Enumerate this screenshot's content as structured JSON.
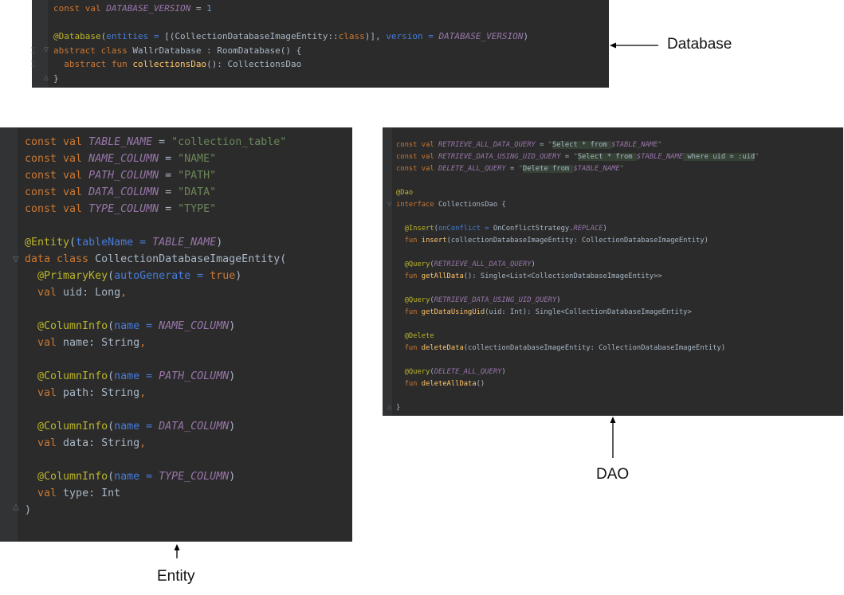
{
  "labels": {
    "database": "Database",
    "entity": "Entity",
    "dao": "DAO"
  },
  "colors": {
    "editor_bg": "#2b2b2b",
    "keyword": "#cc7832",
    "constant": "#9876aa",
    "string": "#6a8759",
    "annotation": "#bbb529",
    "plain": "#a9b7c6",
    "function": "#ffc66d",
    "number": "#6897bb",
    "named_param": "#467cda"
  },
  "database_code": [
    {
      "t": "kw",
      "v": "const val "
    },
    {
      "t": "cst",
      "v": "DATABASE_VERSION"
    },
    {
      "t": "txt",
      "v": " = "
    },
    {
      "t": "num",
      "v": "1"
    },
    {
      "t": "br"
    },
    {
      "t": "br"
    },
    {
      "t": "ann",
      "v": "@Database"
    },
    {
      "t": "txt",
      "v": "("
    },
    {
      "t": "param",
      "v": "entities = "
    },
    {
      "t": "txt",
      "v": "[(CollectionDatabaseImageEntity::"
    },
    {
      "t": "kw",
      "v": "class"
    },
    {
      "t": "txt",
      "v": ")], "
    },
    {
      "t": "param",
      "v": "version = "
    },
    {
      "t": "cst",
      "v": "DATABASE_VERSION"
    },
    {
      "t": "txt",
      "v": ")"
    },
    {
      "t": "br"
    },
    {
      "t": "kw",
      "v": "abstract class "
    },
    {
      "t": "txt",
      "v": "WallrDatabase : RoomDatabase() {"
    },
    {
      "t": "br"
    },
    {
      "t": "txt",
      "v": "  "
    },
    {
      "t": "kw",
      "v": "abstract fun "
    },
    {
      "t": "fn",
      "v": "collectionsDao"
    },
    {
      "t": "txt",
      "v": "(): CollectionsDao"
    },
    {
      "t": "br"
    },
    {
      "t": "txt",
      "v": "}"
    }
  ],
  "entity_code": [
    {
      "t": "kw",
      "v": "const val "
    },
    {
      "t": "cst",
      "v": "TABLE_NAME"
    },
    {
      "t": "txt",
      "v": " = "
    },
    {
      "t": "str",
      "v": "\"collection_table\""
    },
    {
      "t": "br"
    },
    {
      "t": "kw",
      "v": "const val "
    },
    {
      "t": "cst",
      "v": "NAME_COLUMN"
    },
    {
      "t": "txt",
      "v": " = "
    },
    {
      "t": "str",
      "v": "\"NAME\""
    },
    {
      "t": "br"
    },
    {
      "t": "kw",
      "v": "const val "
    },
    {
      "t": "cst",
      "v": "PATH_COLUMN"
    },
    {
      "t": "txt",
      "v": " = "
    },
    {
      "t": "str",
      "v": "\"PATH\""
    },
    {
      "t": "br"
    },
    {
      "t": "kw",
      "v": "const val "
    },
    {
      "t": "cst",
      "v": "DATA_COLUMN"
    },
    {
      "t": "txt",
      "v": " = "
    },
    {
      "t": "str",
      "v": "\"DATA\""
    },
    {
      "t": "br"
    },
    {
      "t": "kw",
      "v": "const val "
    },
    {
      "t": "cst",
      "v": "TYPE_COLUMN"
    },
    {
      "t": "txt",
      "v": " = "
    },
    {
      "t": "str",
      "v": "\"TYPE\""
    },
    {
      "t": "br"
    },
    {
      "t": "br"
    },
    {
      "t": "ann",
      "v": "@Entity"
    },
    {
      "t": "txt",
      "v": "("
    },
    {
      "t": "param",
      "v": "tableName = "
    },
    {
      "t": "cst",
      "v": "TABLE_NAME"
    },
    {
      "t": "txt",
      "v": ")"
    },
    {
      "t": "br"
    },
    {
      "t": "kw",
      "v": "data class "
    },
    {
      "t": "txt",
      "v": "CollectionDatabaseImageEntity("
    },
    {
      "t": "br"
    },
    {
      "t": "txt",
      "v": "  "
    },
    {
      "t": "ann",
      "v": "@PrimaryKey"
    },
    {
      "t": "txt",
      "v": "("
    },
    {
      "t": "param",
      "v": "autoGenerate = "
    },
    {
      "t": "kw",
      "v": "true"
    },
    {
      "t": "txt",
      "v": ")"
    },
    {
      "t": "br"
    },
    {
      "t": "txt",
      "v": "  "
    },
    {
      "t": "kw",
      "v": "val "
    },
    {
      "t": "txt",
      "v": "uid: Long"
    },
    {
      "t": "kw",
      "v": ","
    },
    {
      "t": "br"
    },
    {
      "t": "br"
    },
    {
      "t": "txt",
      "v": "  "
    },
    {
      "t": "ann",
      "v": "@ColumnInfo"
    },
    {
      "t": "txt",
      "v": "("
    },
    {
      "t": "param",
      "v": "name = "
    },
    {
      "t": "cst",
      "v": "NAME_COLUMN"
    },
    {
      "t": "txt",
      "v": ")"
    },
    {
      "t": "br"
    },
    {
      "t": "txt",
      "v": "  "
    },
    {
      "t": "kw",
      "v": "val "
    },
    {
      "t": "txt",
      "v": "name: String"
    },
    {
      "t": "kw",
      "v": ","
    },
    {
      "t": "br"
    },
    {
      "t": "br"
    },
    {
      "t": "txt",
      "v": "  "
    },
    {
      "t": "ann",
      "v": "@ColumnInfo"
    },
    {
      "t": "txt",
      "v": "("
    },
    {
      "t": "param",
      "v": "name = "
    },
    {
      "t": "cst",
      "v": "PATH_COLUMN"
    },
    {
      "t": "txt",
      "v": ")"
    },
    {
      "t": "br"
    },
    {
      "t": "txt",
      "v": "  "
    },
    {
      "t": "kw",
      "v": "val "
    },
    {
      "t": "txt",
      "v": "path: String"
    },
    {
      "t": "kw",
      "v": ","
    },
    {
      "t": "br"
    },
    {
      "t": "br"
    },
    {
      "t": "txt",
      "v": "  "
    },
    {
      "t": "ann",
      "v": "@ColumnInfo"
    },
    {
      "t": "txt",
      "v": "("
    },
    {
      "t": "param",
      "v": "name = "
    },
    {
      "t": "cst",
      "v": "DATA_COLUMN"
    },
    {
      "t": "txt",
      "v": ")"
    },
    {
      "t": "br"
    },
    {
      "t": "txt",
      "v": "  "
    },
    {
      "t": "kw",
      "v": "val "
    },
    {
      "t": "txt",
      "v": "data: String"
    },
    {
      "t": "kw",
      "v": ","
    },
    {
      "t": "br"
    },
    {
      "t": "br"
    },
    {
      "t": "txt",
      "v": "  "
    },
    {
      "t": "ann",
      "v": "@ColumnInfo"
    },
    {
      "t": "txt",
      "v": "("
    },
    {
      "t": "param",
      "v": "name = "
    },
    {
      "t": "cst",
      "v": "TYPE_COLUMN"
    },
    {
      "t": "txt",
      "v": ")"
    },
    {
      "t": "br"
    },
    {
      "t": "txt",
      "v": "  "
    },
    {
      "t": "kw",
      "v": "val "
    },
    {
      "t": "txt",
      "v": "type: Int"
    },
    {
      "t": "br"
    },
    {
      "t": "txt",
      "v": ")"
    }
  ],
  "dao_code": [
    {
      "t": "kw",
      "v": "const val "
    },
    {
      "t": "cst",
      "v": "RETRIEVE_ALL_DATA_QUERY"
    },
    {
      "t": "txt",
      "v": " = "
    },
    {
      "t": "str",
      "v": "\""
    },
    {
      "t": "hl",
      "v": "Select * from "
    },
    {
      "t": "cst",
      "v": "$TABLE_NAME"
    },
    {
      "t": "str",
      "v": "\""
    },
    {
      "t": "br"
    },
    {
      "t": "kw",
      "v": "const val "
    },
    {
      "t": "cst",
      "v": "RETRIEVE_DATA_USING_UID_QUERY"
    },
    {
      "t": "txt",
      "v": " = "
    },
    {
      "t": "str",
      "v": "\""
    },
    {
      "t": "hl",
      "v": "Select * from "
    },
    {
      "t": "cst",
      "v": "$TABLE_NAME"
    },
    {
      "t": "hl",
      "v": " where uid = :uid"
    },
    {
      "t": "str",
      "v": "\""
    },
    {
      "t": "br"
    },
    {
      "t": "kw",
      "v": "const val "
    },
    {
      "t": "cst",
      "v": "DELETE_ALL_QUERY"
    },
    {
      "t": "txt",
      "v": " = "
    },
    {
      "t": "str",
      "v": "\""
    },
    {
      "t": "hl",
      "v": "Delete from "
    },
    {
      "t": "cst",
      "v": "$TABLE_NAME"
    },
    {
      "t": "str",
      "v": "\""
    },
    {
      "t": "br"
    },
    {
      "t": "br"
    },
    {
      "t": "ann",
      "v": "@Dao"
    },
    {
      "t": "br"
    },
    {
      "t": "kw",
      "v": "interface "
    },
    {
      "t": "txt",
      "v": "CollectionsDao {"
    },
    {
      "t": "br"
    },
    {
      "t": "br"
    },
    {
      "t": "txt",
      "v": "  "
    },
    {
      "t": "ann",
      "v": "@Insert"
    },
    {
      "t": "txt",
      "v": "("
    },
    {
      "t": "param",
      "v": "onConflict = "
    },
    {
      "t": "txt",
      "v": "OnConflictStrategy."
    },
    {
      "t": "cst",
      "v": "REPLACE"
    },
    {
      "t": "txt",
      "v": ")"
    },
    {
      "t": "br"
    },
    {
      "t": "txt",
      "v": "  "
    },
    {
      "t": "kw",
      "v": "fun "
    },
    {
      "t": "fn",
      "v": "insert"
    },
    {
      "t": "txt",
      "v": "(collectionDatabaseImageEntity: CollectionDatabaseImageEntity)"
    },
    {
      "t": "br"
    },
    {
      "t": "br"
    },
    {
      "t": "txt",
      "v": "  "
    },
    {
      "t": "ann",
      "v": "@Query"
    },
    {
      "t": "txt",
      "v": "("
    },
    {
      "t": "cst",
      "v": "RETRIEVE_ALL_DATA_QUERY"
    },
    {
      "t": "txt",
      "v": ")"
    },
    {
      "t": "br"
    },
    {
      "t": "txt",
      "v": "  "
    },
    {
      "t": "kw",
      "v": "fun "
    },
    {
      "t": "fn",
      "v": "getAllData"
    },
    {
      "t": "txt",
      "v": "(): Single<List<CollectionDatabaseImageEntity>>"
    },
    {
      "t": "br"
    },
    {
      "t": "br"
    },
    {
      "t": "txt",
      "v": "  "
    },
    {
      "t": "ann",
      "v": "@Query"
    },
    {
      "t": "txt",
      "v": "("
    },
    {
      "t": "cst",
      "v": "RETRIEVE_DATA_USING_UID_QUERY"
    },
    {
      "t": "txt",
      "v": ")"
    },
    {
      "t": "br"
    },
    {
      "t": "txt",
      "v": "  "
    },
    {
      "t": "kw",
      "v": "fun "
    },
    {
      "t": "fn",
      "v": "getDataUsingUid"
    },
    {
      "t": "txt",
      "v": "(uid: Int): Single<CollectionDatabaseImageEntity>"
    },
    {
      "t": "br"
    },
    {
      "t": "br"
    },
    {
      "t": "txt",
      "v": "  "
    },
    {
      "t": "ann",
      "v": "@Delete"
    },
    {
      "t": "br"
    },
    {
      "t": "txt",
      "v": "  "
    },
    {
      "t": "kw",
      "v": "fun "
    },
    {
      "t": "fn",
      "v": "deleteData"
    },
    {
      "t": "txt",
      "v": "(collectionDatabaseImageEntity: CollectionDatabaseImageEntity)"
    },
    {
      "t": "br"
    },
    {
      "t": "br"
    },
    {
      "t": "txt",
      "v": "  "
    },
    {
      "t": "ann",
      "v": "@Query"
    },
    {
      "t": "txt",
      "v": "("
    },
    {
      "t": "cst",
      "v": "DELETE_ALL_QUERY"
    },
    {
      "t": "txt",
      "v": ")"
    },
    {
      "t": "br"
    },
    {
      "t": "txt",
      "v": "  "
    },
    {
      "t": "kw",
      "v": "fun "
    },
    {
      "t": "fn",
      "v": "deleteAllData"
    },
    {
      "t": "txt",
      "v": "()"
    },
    {
      "t": "br"
    },
    {
      "t": "br"
    },
    {
      "t": "txt",
      "v": "}"
    }
  ]
}
